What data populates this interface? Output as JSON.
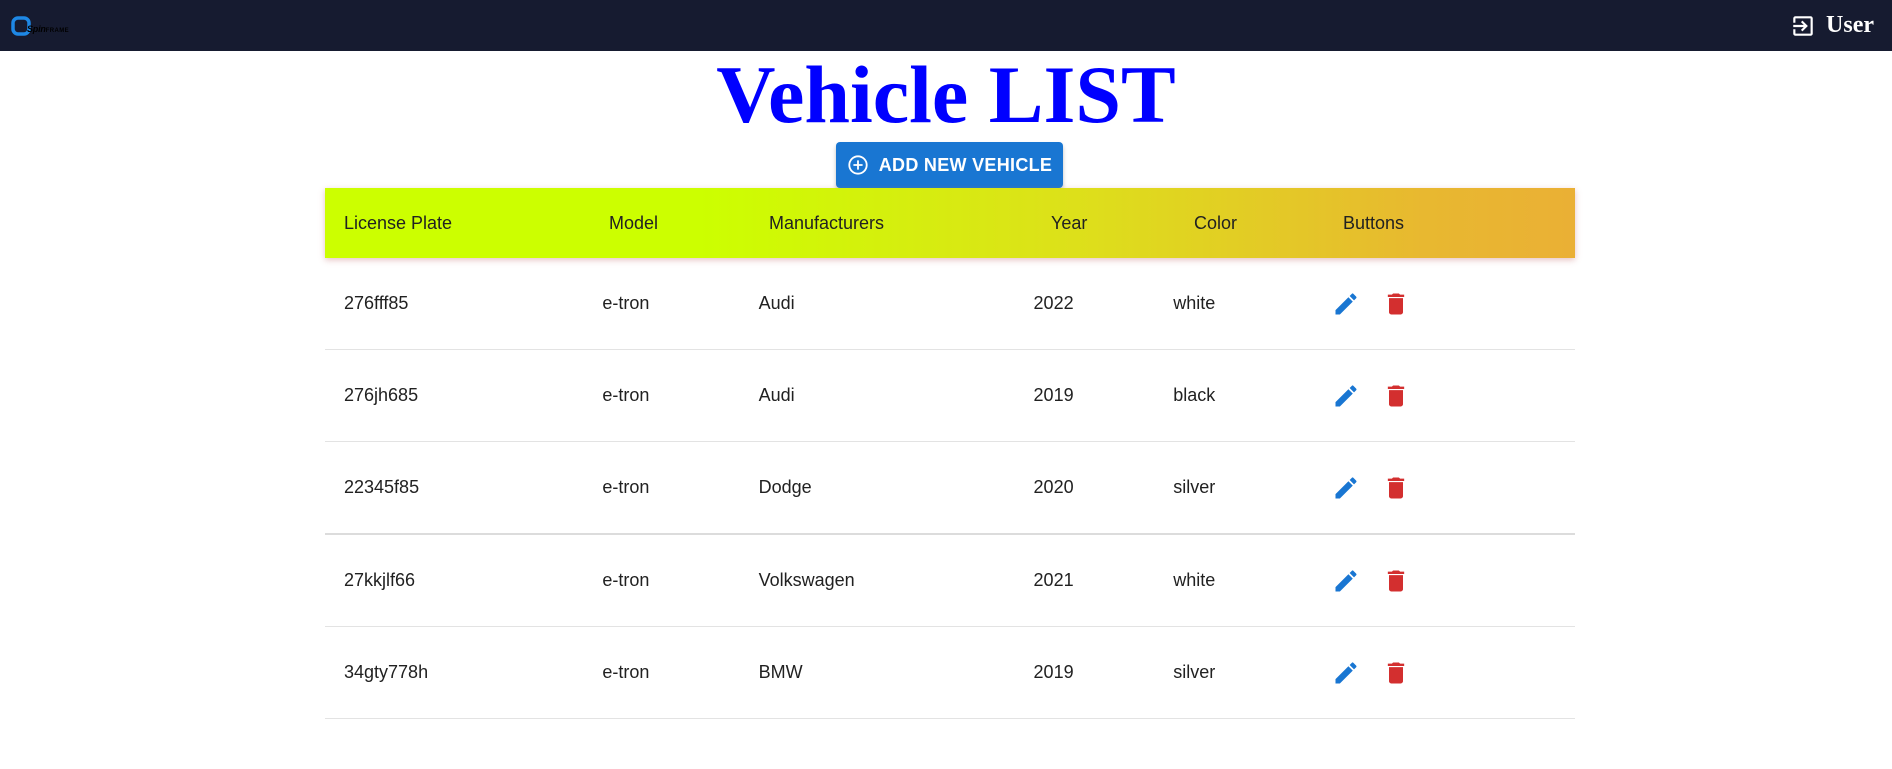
{
  "header": {
    "logo_text": "Spin",
    "logo_text_suffix": "FRAME",
    "user_label": "User",
    "colors": {
      "background": "#161b30",
      "text": "#ffffff"
    },
    "icons": {
      "logo": "spinframe-logo-icon",
      "user": "login-icon"
    }
  },
  "page": {
    "title": "Vehicle LIST",
    "title_color": "#0000ff"
  },
  "toolbar": {
    "add_label": "ADD NEW VEHICLE",
    "add_icon": "add-circle-outline-icon",
    "add_color": "#1976d2"
  },
  "table": {
    "columns": [
      "License Plate",
      "Model",
      "Manufacturers",
      "Year",
      "Color",
      "Buttons"
    ],
    "header_gradient": [
      "#ccff00",
      "#eab035"
    ],
    "rows": [
      {
        "license_plate": "276fff85",
        "model": "e-tron",
        "manufacturer": "Audi",
        "year": "2022",
        "color": "white"
      },
      {
        "license_plate": "276jh685",
        "model": "e-tron",
        "manufacturer": "Audi",
        "year": "2019",
        "color": "black"
      },
      {
        "license_plate": "22345f85",
        "model": "e-tron",
        "manufacturer": "Dodge",
        "year": "2020",
        "color": "silver"
      },
      {
        "license_plate": "27kkjlf66",
        "model": "e-tron",
        "manufacturer": "Volkswagen",
        "year": "2021",
        "color": "white"
      },
      {
        "license_plate": "34gty778h",
        "model": "e-tron",
        "manufacturer": "BMW",
        "year": "2019",
        "color": "silver"
      }
    ],
    "row_actions": {
      "edit_icon": "pencil-icon",
      "edit_color": "#1976d2",
      "delete_icon": "trash-icon",
      "delete_color": "#d32f2f"
    }
  }
}
